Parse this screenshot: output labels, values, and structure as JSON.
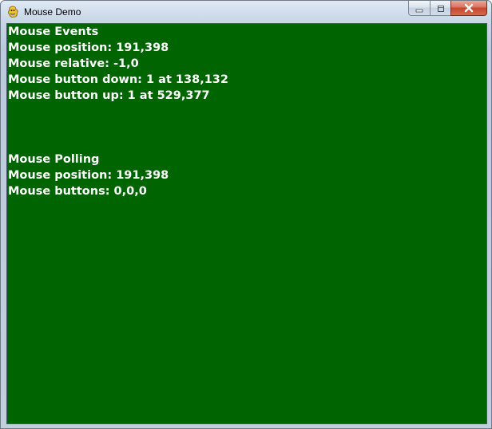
{
  "window": {
    "title": "Mouse Demo",
    "app_icon": "pygame-snake-icon",
    "controls": {
      "minimize_icon": "minimize-icon",
      "maximize_icon": "maximize-icon",
      "close_icon": "close-icon"
    }
  },
  "canvas": {
    "background": "#006400",
    "text_color": "#ffffff",
    "events": {
      "heading": "Mouse Events",
      "position": "Mouse position: 191,398",
      "relative": "Mouse relative: -1,0",
      "button_down": "Mouse button down: 1 at 138,132",
      "button_up": "Mouse button up: 1 at 529,377"
    },
    "polling": {
      "heading": "Mouse Polling",
      "position": "Mouse position: 191,398",
      "buttons": "Mouse buttons: 0,0,0"
    }
  }
}
